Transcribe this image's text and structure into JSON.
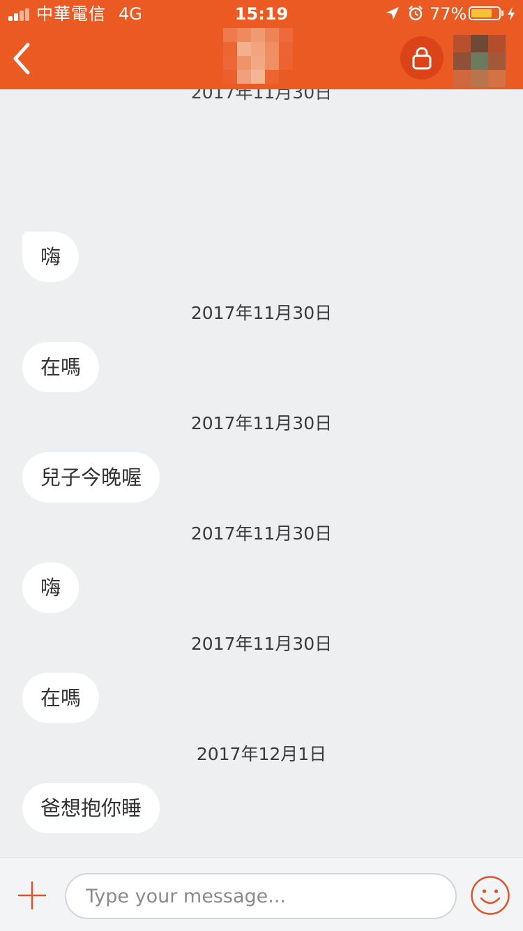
{
  "status_bar": {
    "carrier": "中華電信",
    "network": "4G",
    "time": "15:19",
    "battery_percent": "77%",
    "battery_level": 0.77
  },
  "header": {
    "back_icon": "chevron-left-icon",
    "lock_icon": "lock-icon"
  },
  "conversation": {
    "partial_top_date": "2017年11月30日",
    "messages": [
      {
        "date": null,
        "text": "嗨"
      },
      {
        "date": "2017年11月30日",
        "text": "在嗎"
      },
      {
        "date": "2017年11月30日",
        "text": "兒子今晚喔"
      },
      {
        "date": "2017年11月30日",
        "text": "嗨"
      },
      {
        "date": "2017年11月30日",
        "text": "在嗎"
      },
      {
        "date": "2017年12月1日",
        "text": "爸想抱你睡"
      }
    ]
  },
  "composer": {
    "add_icon": "plus-icon",
    "placeholder": "Type your message...",
    "value": "",
    "emoji_icon": "smiley-icon"
  },
  "colors": {
    "header": "#ec5a24",
    "accent": "#e0522a",
    "background": "#eeeff1",
    "bubble": "#ffffff"
  }
}
